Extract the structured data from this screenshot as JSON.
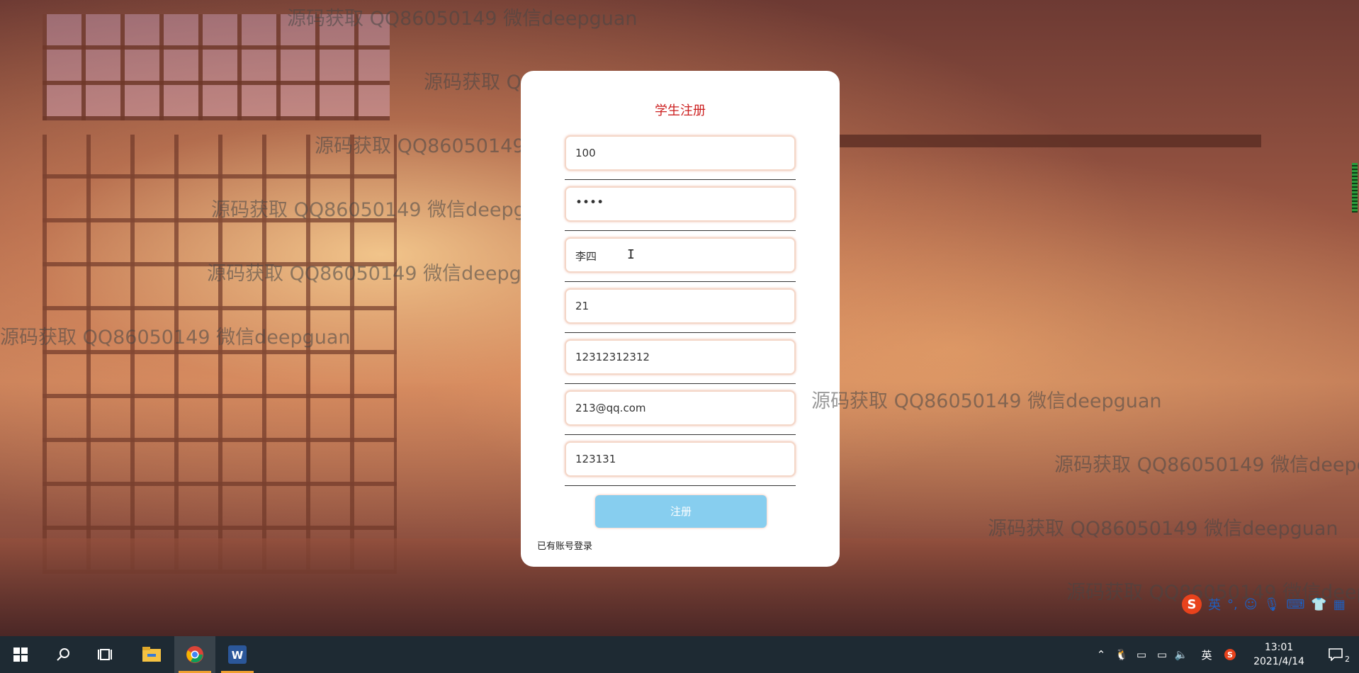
{
  "watermark_text": "源码获取 QQ86050149 微信deepguan",
  "form": {
    "title": "学生注册",
    "fields": [
      {
        "value": "100"
      },
      {
        "value": "••••"
      },
      {
        "value": "李四"
      },
      {
        "value": "21"
      },
      {
        "value": "12312312312"
      },
      {
        "value": "213@qq.com"
      },
      {
        "value": "123131"
      }
    ],
    "register_label": "注册",
    "login_link": "已有账号登录"
  },
  "ime": {
    "logo": "S",
    "lang": "英",
    "icons": [
      "punctuation-icon",
      "emoji-icon",
      "microphone-icon",
      "keyboard-icon",
      "shirt-icon",
      "toolbox-icon"
    ]
  },
  "taskbar": {
    "apps": [
      "windows-start-icon",
      "search-icon",
      "task-view-icon",
      "file-explorer-icon",
      "chrome-icon",
      "word-icon"
    ],
    "tray_lang": "英",
    "time": "13:01",
    "date": "2021/4/14",
    "notifications": "2"
  },
  "colors": {
    "title_red": "#cc1f1f",
    "button_blue": "#87ceef",
    "taskbar": "#1e2a33"
  }
}
